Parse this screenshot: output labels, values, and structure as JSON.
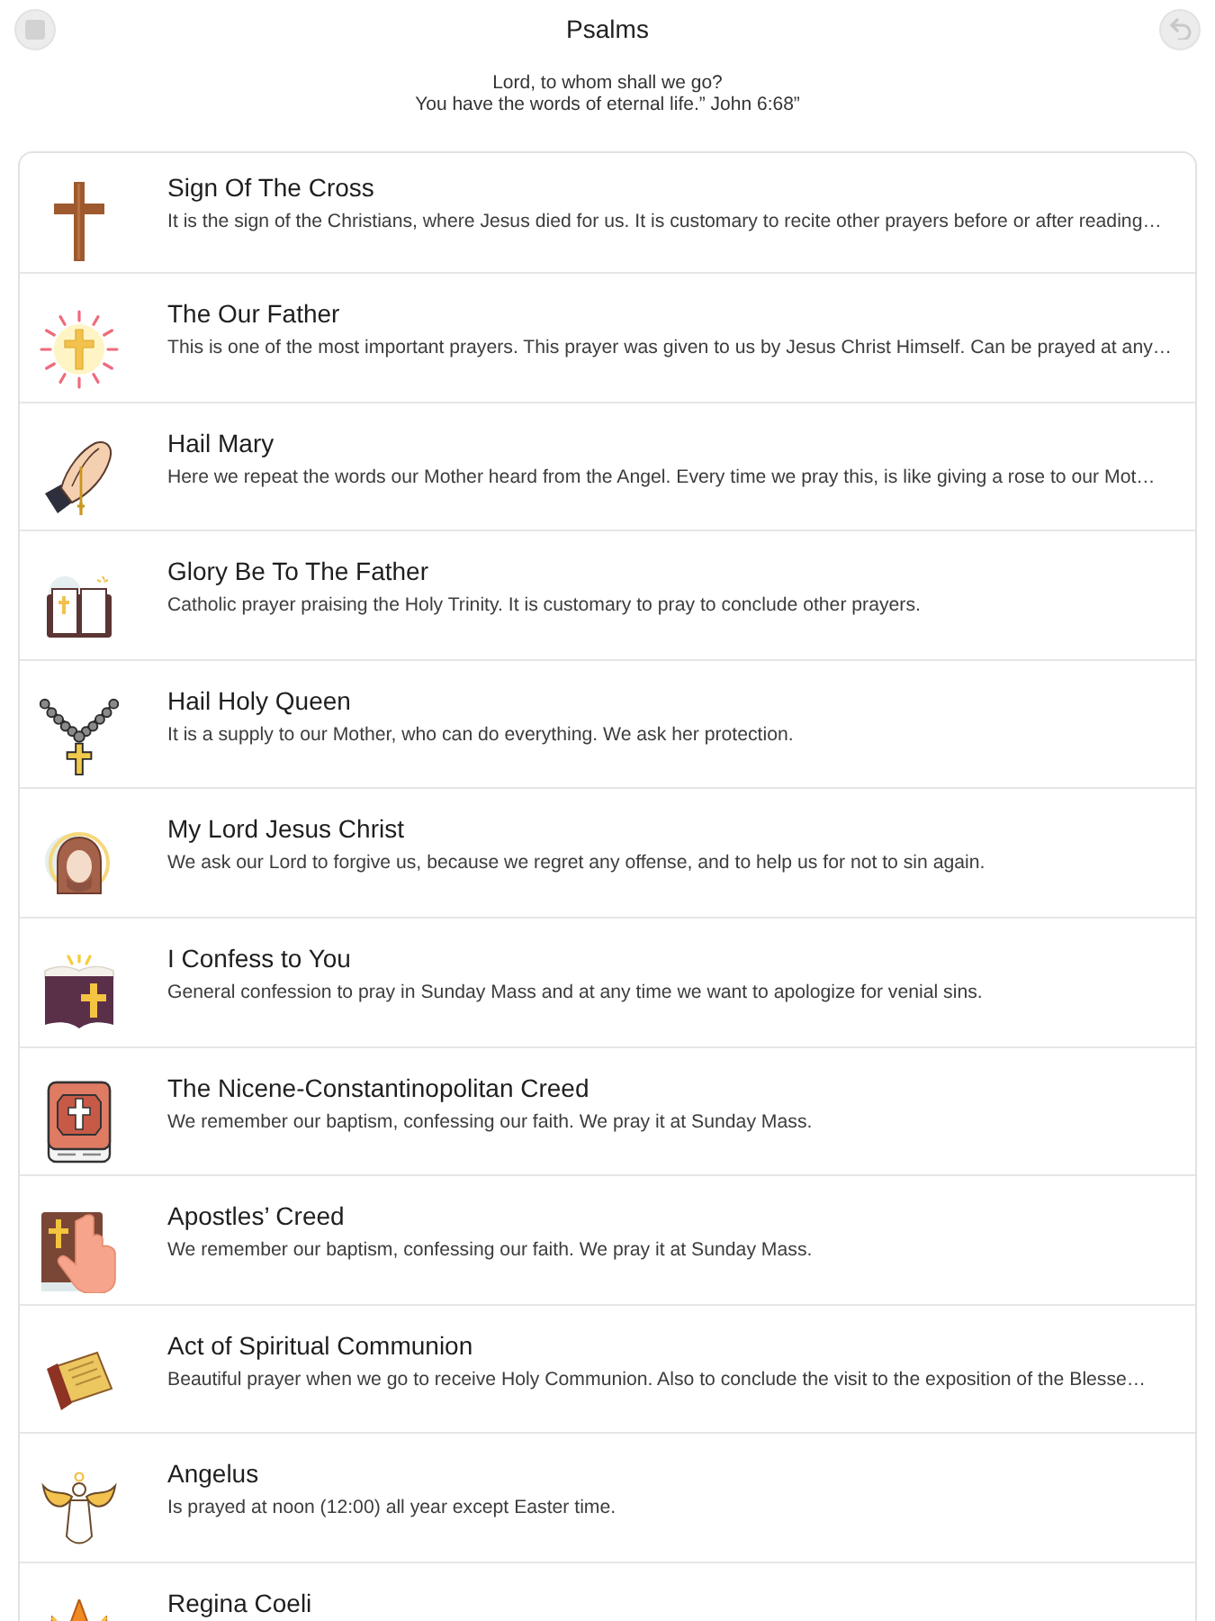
{
  "header": {
    "title": "Psalms",
    "quote_lines": [
      "Lord, to whom shall we go?",
      "You have the words of eternal life.” John 6:68”"
    ]
  },
  "prayers": [
    {
      "title": "Sign Of The Cross",
      "description": "It is the sign of the Christians, where Jesus died for us. It is customary to recite other prayers before or after reading…"
    },
    {
      "title": "The Our Father",
      "description": "This is one of the most important prayers. This prayer was given to us by Jesus Christ Himself. Can be prayed at any…"
    },
    {
      "title": "Hail Mary",
      "description": "Here we repeat the words our Mother heard from the Angel. Every time we pray this, is like giving a rose to our Mot…"
    },
    {
      "title": "Glory Be To The Father",
      "description": "Catholic prayer praising the Holy Trinity. It is customary to pray to conclude other prayers."
    },
    {
      "title": "Hail Holy Queen",
      "description": "It is a supply to our Mother, who can do everything. We ask her protection."
    },
    {
      "title": "My Lord Jesus Christ",
      "description": "We ask our Lord to forgive us, because we regret any offense, and to help us for not to sin again."
    },
    {
      "title": "I Confess to You",
      "description": "General confession to pray in Sunday Mass and at any time we want to apologize for venial sins."
    },
    {
      "title": "The Nicene-Constantinopolitan Creed",
      "description": "We remember our baptism, confessing our faith. We pray it at Sunday Mass."
    },
    {
      "title": "Apostles’ Creed",
      "description": "We remember our baptism, confessing our faith. We pray it at Sunday Mass."
    },
    {
      "title": "Act of Spiritual Communion",
      "description": "Beautiful prayer when we go to receive Holy Communion. Also to conclude the visit to the exposition of the Blesse…"
    },
    {
      "title": "Angelus",
      "description": "Is prayed at noon (12:00) all year except Easter time."
    },
    {
      "title": "Regina Coeli"
    }
  ]
}
